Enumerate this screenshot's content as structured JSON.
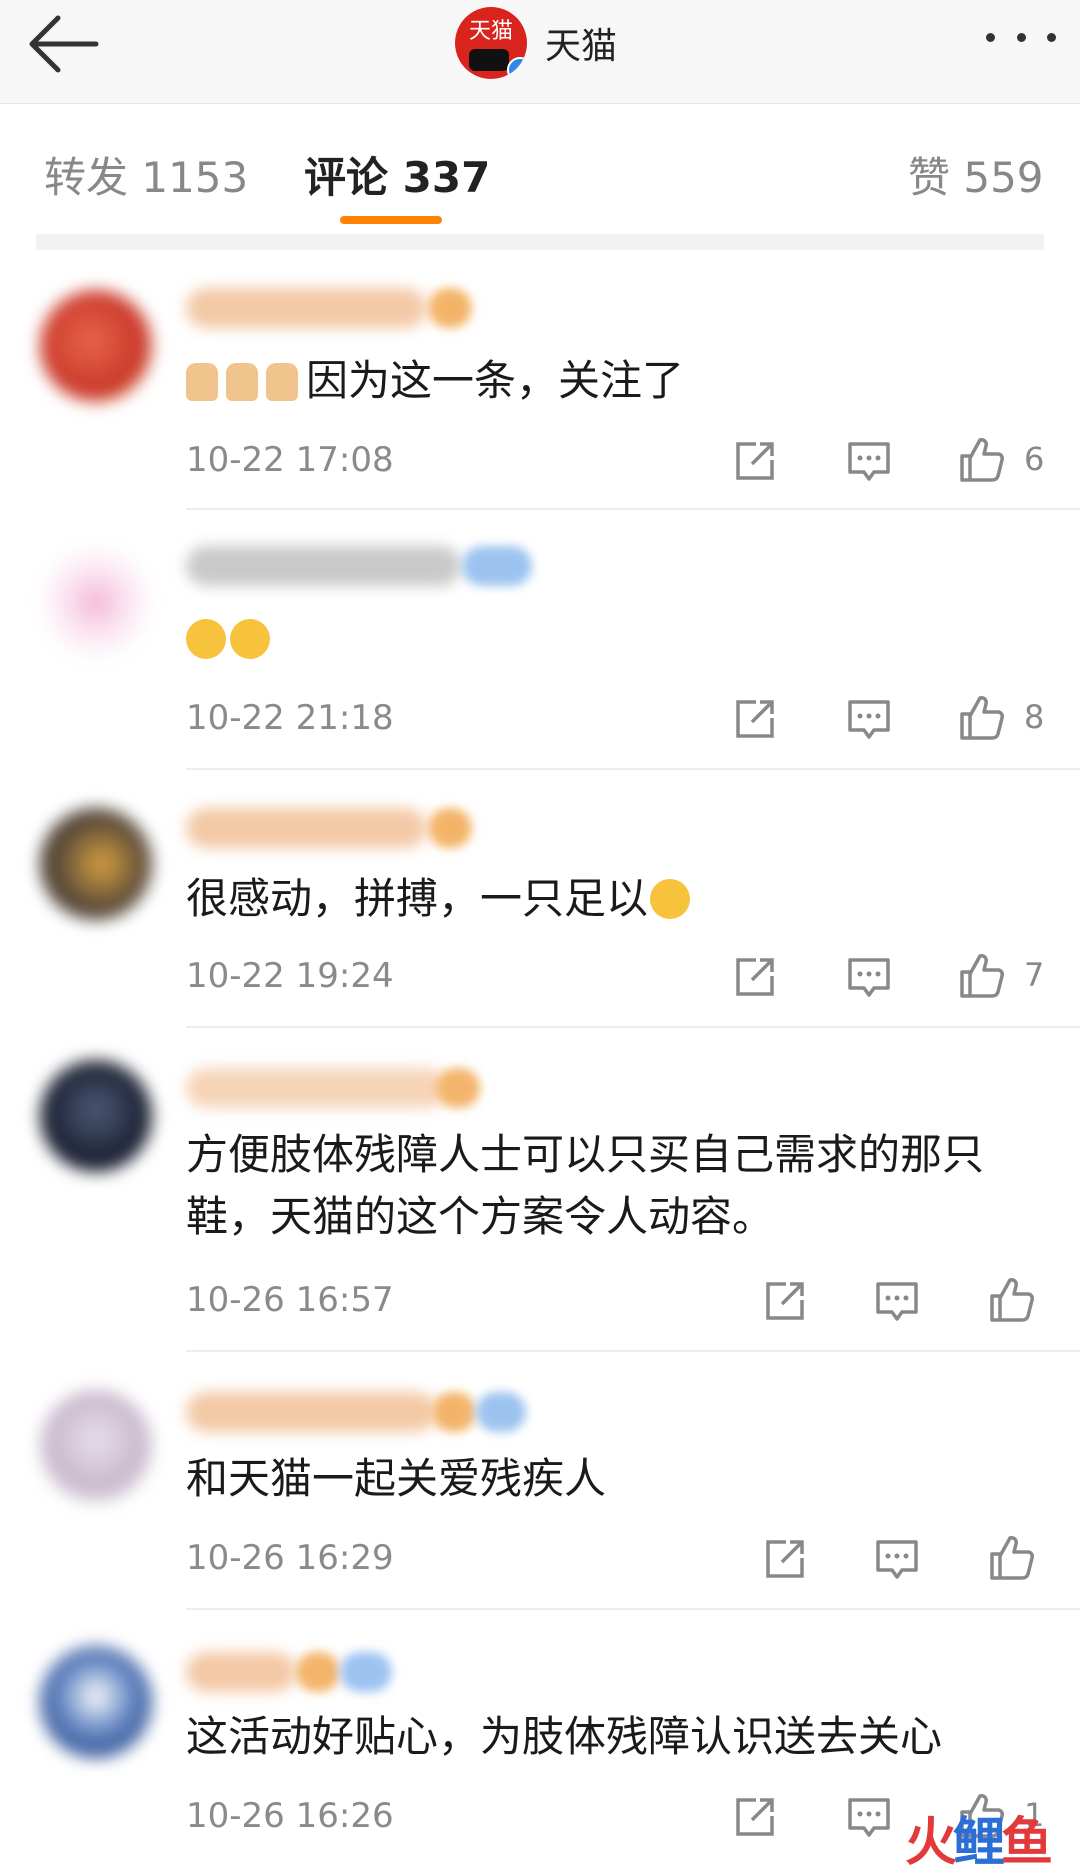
{
  "header": {
    "logo_text": "天猫",
    "title": "天猫",
    "back_icon": "back-arrow-icon",
    "more_icon": "more-dots-icon",
    "verified_icon": "verified-badge-icon"
  },
  "tabs": [
    {
      "label": "转发 1153"
    },
    {
      "label": "评论 337"
    },
    {
      "label": "赞 559"
    }
  ],
  "accent_color": "#ff8200",
  "comments": [
    {
      "text": "因为这一条，关注了",
      "time": "10-22 17:08",
      "likes": "6"
    },
    {
      "text": "",
      "time": "10-22 21:18",
      "likes": "8"
    },
    {
      "text": "很感动，拼搏，一只足以",
      "time": "10-22 19:24",
      "likes": "7"
    },
    {
      "text": "方便肢体残障人士可以只买自己需求的那只鞋，天猫的这个方案令人动容。",
      "time": "10-26 16:57",
      "likes": ""
    },
    {
      "text": "和天猫一起关爱残疾人",
      "time": "10-26 16:29",
      "likes": ""
    },
    {
      "text": "这活动好贴心，为肢体残障认识送去关心",
      "time": "10-26 16:26",
      "likes": "1"
    }
  ],
  "watermark": {
    "part1": "火",
    "part2": "鲤",
    "part3": "鱼"
  }
}
